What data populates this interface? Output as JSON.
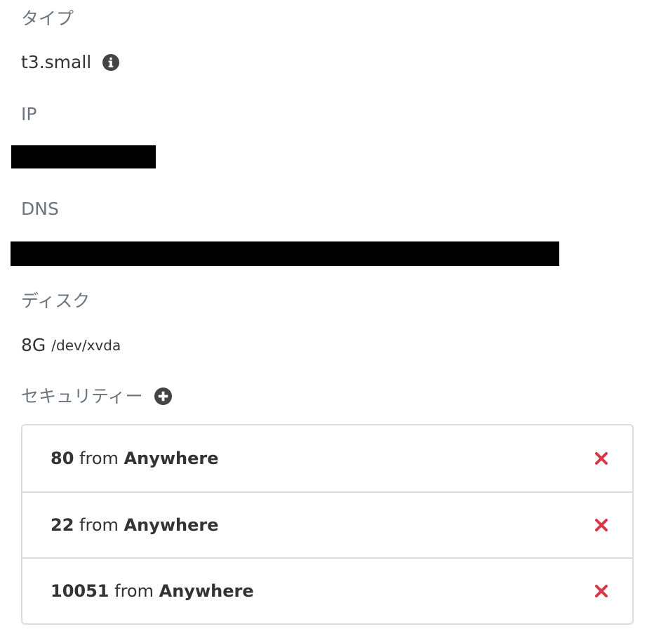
{
  "type_section": {
    "label": "タイプ",
    "value": "t3.small"
  },
  "ip_section": {
    "label": "IP"
  },
  "dns_section": {
    "label": "DNS"
  },
  "disk_section": {
    "label": "ディスク",
    "size": "8G",
    "path": "/dev/xvda"
  },
  "security_section": {
    "label": "セキュリティー",
    "rules": [
      {
        "port": "80",
        "from_word": "from",
        "source": "Anywhere"
      },
      {
        "port": "22",
        "from_word": "from",
        "source": "Anywhere"
      },
      {
        "port": "10051",
        "from_word": "from",
        "source": "Anywhere"
      }
    ]
  },
  "colors": {
    "label": "#6c757d",
    "text": "#333333",
    "remove": "#dc3545",
    "border": "#dddddd"
  },
  "icons": {
    "info": "info-circle-icon",
    "add": "plus-circle-icon",
    "remove": "close-icon"
  }
}
